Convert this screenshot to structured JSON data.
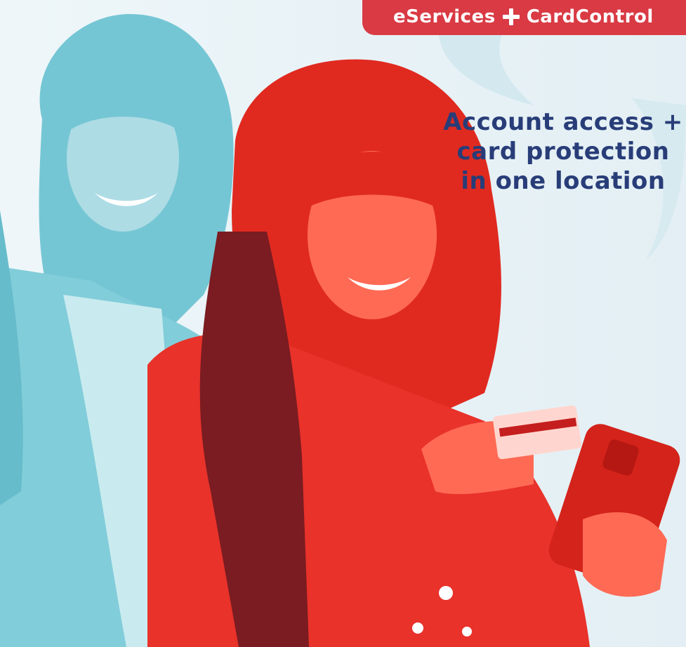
{
  "banner": {
    "part1": "eServices",
    "part2": "CardControl"
  },
  "headline": {
    "line1": "Account access +",
    "line2": "card protection",
    "line3": "in one location"
  },
  "colors": {
    "banner_red": "#d93a44",
    "headline_navy": "#283d78",
    "tint_blue": "#6fc4d3",
    "tint_red": "#f2382c",
    "background": "#eef6f9"
  },
  "icons": [
    "plus-icon"
  ]
}
